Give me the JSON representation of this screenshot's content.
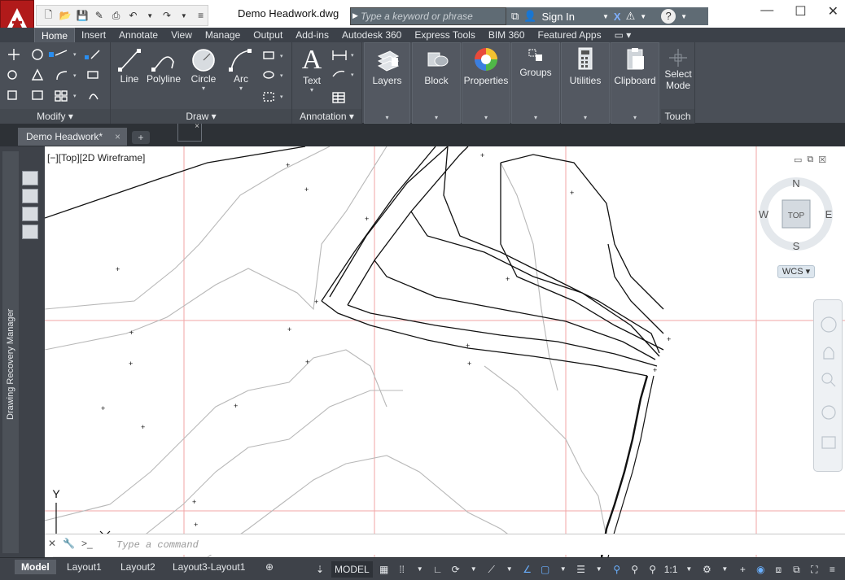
{
  "title_bar": {
    "document_title": "Demo Headwork.dwg",
    "search_placeholder": "Type a keyword or phrase",
    "sign_in": "Sign In",
    "help": "?"
  },
  "quick_access": [
    "new-icon",
    "open-icon",
    "save-icon",
    "saveas-icon",
    "plot-icon",
    "undo-icon",
    "redo-icon",
    "customize-icon"
  ],
  "ribbon_tabs": [
    "Home",
    "Insert",
    "Annotate",
    "View",
    "Manage",
    "Output",
    "Add-ins",
    "Autodesk 360",
    "Express Tools",
    "BIM 360",
    "Featured Apps"
  ],
  "ribbon_active_tab": "Home",
  "ribbon": {
    "modify_label": "Modify",
    "draw_label": "Draw",
    "annotation_label": "Annotation",
    "touch_label": "Touch",
    "draw_tools": [
      "Line",
      "Polyline",
      "Circle",
      "Arc"
    ],
    "text_tool": "Text",
    "layers": "Layers",
    "block": "Block",
    "properties": "Properties",
    "groups": "Groups",
    "utilities": "Utilities",
    "clipboard": "Clipboard",
    "select_mode_1": "Select",
    "select_mode_2": "Mode"
  },
  "doc_tab": {
    "label": "Demo Headwork*",
    "close": "×",
    "new": "+"
  },
  "palette": {
    "title": "Drawing Recovery Manager"
  },
  "viewport": {
    "label": "[−][Top][2D Wireframe]",
    "compass": {
      "n": "N",
      "s": "S",
      "e": "E",
      "w": "W",
      "top": "TOP"
    },
    "wcs": "WCS",
    "ucs_y": "Y"
  },
  "command_line": {
    "placeholder": "Type a command"
  },
  "layout_tabs": [
    "Model",
    "Layout1",
    "Layout2",
    "Layout3-Layout1"
  ],
  "layout_active": "Model",
  "status": {
    "model": "MODEL",
    "scale": "1:1"
  },
  "colors": {
    "app_red": "#b11a1a",
    "ribbon_dark": "#4a4f57",
    "grid_red": "#f08080"
  }
}
